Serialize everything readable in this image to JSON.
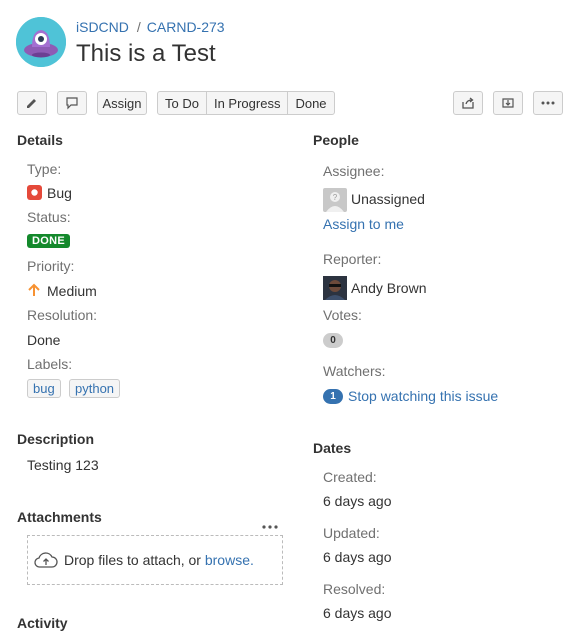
{
  "header": {
    "project_key": "iSDCND",
    "separator": "/",
    "issue_key": "CARND-273",
    "title": "This is a Test"
  },
  "toolbar": {
    "edit_icon": "pencil-icon",
    "comment_icon": "comment-icon",
    "assign_label": "Assign",
    "workflow": [
      "To Do",
      "In Progress",
      "Done"
    ],
    "share_icon": "share-icon",
    "export_icon": "export-icon",
    "more_icon": "more-icon"
  },
  "details": {
    "heading": "Details",
    "type_label": "Type:",
    "type_value": "Bug",
    "status_label": "Status:",
    "status_value": "DONE",
    "priority_label": "Priority:",
    "priority_value": "Medium",
    "resolution_label": "Resolution:",
    "resolution_value": "Done",
    "labels_label": "Labels:",
    "labels": [
      "bug",
      "python"
    ]
  },
  "people": {
    "heading": "People",
    "assignee_label": "Assignee:",
    "assignee_value": "Unassigned",
    "assign_to_me": "Assign to me",
    "reporter_label": "Reporter:",
    "reporter_value": "Andy Brown",
    "votes_label": "Votes:",
    "votes_count": "0",
    "watchers_label": "Watchers:",
    "watchers_count": "1",
    "watch_link": "Stop watching this issue"
  },
  "description": {
    "heading": "Description",
    "text": "Testing 123"
  },
  "attachments": {
    "heading": "Attachments",
    "drop_text": "Drop files to attach, or",
    "browse_link": "browse."
  },
  "activity": {
    "heading": "Activity"
  },
  "dates": {
    "heading": "Dates",
    "created_label": "Created:",
    "created_value": "6 days ago",
    "updated_label": "Updated:",
    "updated_value": "6 days ago",
    "resolved_label": "Resolved:",
    "resolved_value": "6 days ago"
  },
  "colors": {
    "link": "#3572b0",
    "done_green": "#14892c",
    "bug_red": "#e5493a",
    "priority_orange": "#f79232",
    "project_teal": "#4fc3d7"
  }
}
